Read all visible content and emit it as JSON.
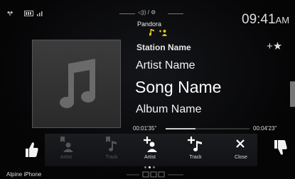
{
  "status": {
    "clock": "09:41",
    "ampm": "AM",
    "center_glyphs": "◁)) / ⚙"
  },
  "now_playing": {
    "source": "Pandora",
    "station": "Station Name",
    "artist": "Artist Name",
    "song": "Song Name",
    "album": "Album Name",
    "elapsed": "00:01'35\"",
    "total": "00:04'23\"",
    "progress": 0.36,
    "favorite_glyph": "+★"
  },
  "controls": {
    "artist_disabled_label": "Artist",
    "track_disabled_label": "Track",
    "add_artist_label": "Artist",
    "add_track_label": "Track",
    "close_label": "Close"
  },
  "pager": {
    "pages": 3,
    "current": 2
  },
  "footer": {
    "device": "Alpine iPhone"
  },
  "colors": {
    "accent": "#ffffff",
    "dim": "#666666",
    "panel": "#16171a",
    "note_icon": "#e8c21c"
  }
}
